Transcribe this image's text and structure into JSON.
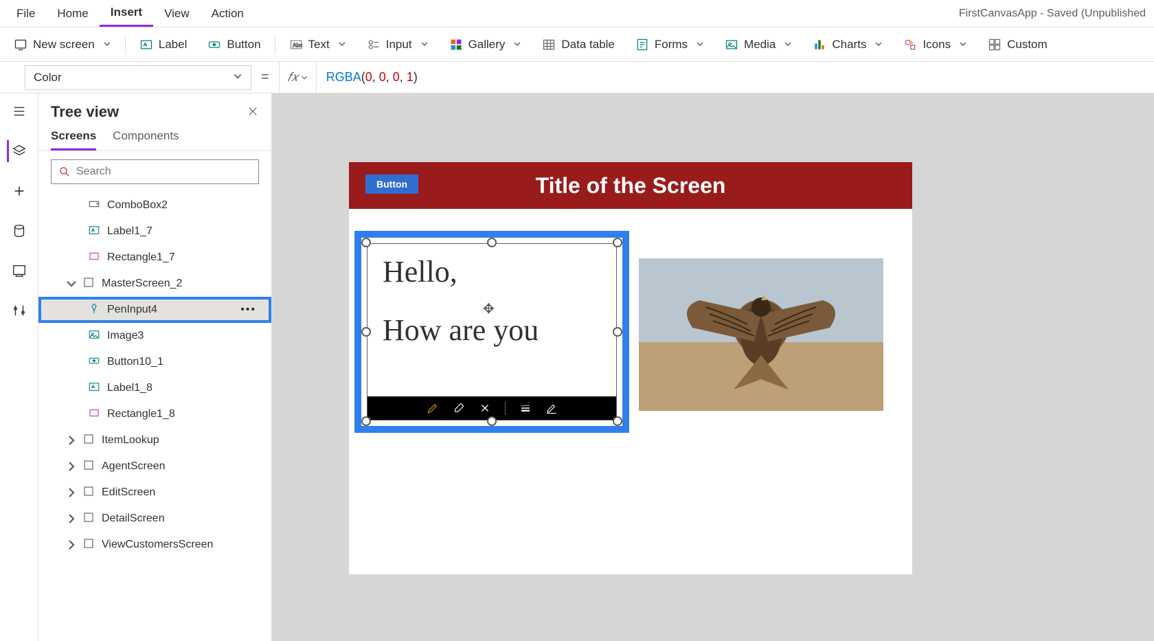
{
  "app_title": "FirstCanvasApp - Saved (Unpublished",
  "menus": {
    "file": "File",
    "home": "Home",
    "insert": "Insert",
    "view": "View",
    "action": "Action"
  },
  "ribbon": {
    "new_screen": "New screen",
    "label": "Label",
    "button": "Button",
    "text": "Text",
    "input": "Input",
    "gallery": "Gallery",
    "data_table": "Data table",
    "forms": "Forms",
    "media": "Media",
    "charts": "Charts",
    "icons": "Icons",
    "custom": "Custom"
  },
  "formula": {
    "property": "Color",
    "func": "RGBA",
    "args": [
      "0",
      "0",
      "0",
      "1"
    ]
  },
  "tree": {
    "title": "Tree view",
    "tabs": {
      "screens": "Screens",
      "components": "Components"
    },
    "search_placeholder": "Search",
    "items": [
      {
        "level": 3,
        "icon": "combo",
        "label": "ComboBox2"
      },
      {
        "level": 3,
        "icon": "label",
        "label": "Label1_7"
      },
      {
        "level": 3,
        "icon": "rect",
        "label": "Rectangle1_7"
      },
      {
        "level": 2,
        "icon": "screen",
        "label": "MasterScreen_2",
        "expanded": true
      },
      {
        "level": 3,
        "icon": "pen",
        "label": "PenInput4",
        "selected": true,
        "more": true
      },
      {
        "level": 3,
        "icon": "image",
        "label": "Image3"
      },
      {
        "level": 3,
        "icon": "button",
        "label": "Button10_1"
      },
      {
        "level": 3,
        "icon": "label",
        "label": "Label1_8"
      },
      {
        "level": 3,
        "icon": "rect",
        "label": "Rectangle1_8"
      },
      {
        "level": 2,
        "icon": "screen",
        "label": "ItemLookup",
        "collapsed": true
      },
      {
        "level": 2,
        "icon": "screen",
        "label": "AgentScreen",
        "collapsed": true
      },
      {
        "level": 2,
        "icon": "screen",
        "label": "EditScreen",
        "collapsed": true
      },
      {
        "level": 2,
        "icon": "screen",
        "label": "DetailScreen",
        "collapsed": true
      },
      {
        "level": 2,
        "icon": "screen",
        "label": "ViewCustomersScreen",
        "collapsed": true
      }
    ]
  },
  "canvas": {
    "title": "Title of the Screen",
    "button": "Button",
    "ink_line1": "Hello,",
    "ink_line2": "How are you"
  }
}
